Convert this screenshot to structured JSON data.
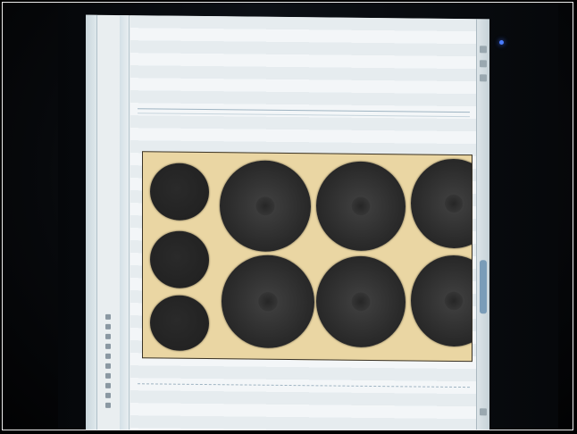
{
  "scene": "photo-of-monitor",
  "monitor": {
    "led_color": "#4a7dff"
  },
  "editor": {
    "page_color": "#e9eef0",
    "artboard": {
      "background": "#ead6a3",
      "disc_color": "#262626",
      "large_discs_count": 8,
      "small_discs_count": 3
    }
  }
}
